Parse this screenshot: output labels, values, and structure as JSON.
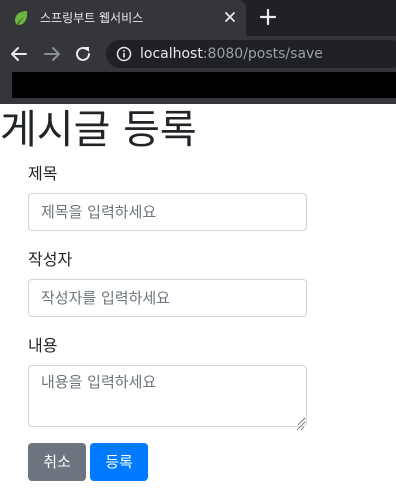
{
  "browser": {
    "tab_title": "스프링부트 웹서비스",
    "url_host": "localhost",
    "url_rest": ":8080/posts/save"
  },
  "page": {
    "title": "게시글 등록"
  },
  "form": {
    "title_label": "제목",
    "title_placeholder": "제목을 입력하세요",
    "author_label": "작성자",
    "author_placeholder": "작성자를 입력하세요",
    "content_label": "내용",
    "content_placeholder": "내용을 입력하세요"
  },
  "buttons": {
    "cancel_label": "취소",
    "submit_label": "등록"
  },
  "colors": {
    "cancel": "#6c757d",
    "submit": "#007bff",
    "favicon": "#6db33f"
  },
  "icons": [
    "spring-leaf-icon",
    "close-icon",
    "plus-icon",
    "arrow-back-icon",
    "arrow-forward-icon",
    "reload-icon",
    "info-icon"
  ]
}
